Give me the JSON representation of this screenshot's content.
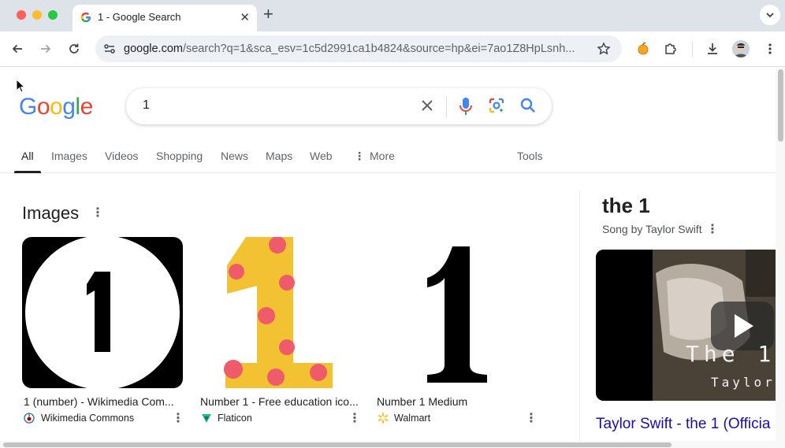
{
  "browser": {
    "tab_title": "1 - Google Search",
    "url_host": "google.com",
    "url_path": "/search?q=1&sca_esv=1c5d2991ca1b4824&source=hp&ei=7ao1Z8HpLsnh..."
  },
  "search": {
    "logo_text": "Google",
    "query": "1"
  },
  "nav": {
    "tabs": [
      "All",
      "Images",
      "Videos",
      "Shopping",
      "News",
      "Maps",
      "Web",
      "More"
    ],
    "tools": "Tools"
  },
  "images_section": {
    "heading": "Images",
    "items": [
      {
        "title": "1 (number) - Wikimedia Com...",
        "source": "Wikimedia Commons"
      },
      {
        "title": "Number 1 - Free education ico...",
        "source": "Flaticon"
      },
      {
        "title": "Number 1 Medium",
        "source": "Walmart"
      }
    ]
  },
  "knowledge_panel": {
    "title": "the 1",
    "subtitle": "Song by Taylor Swift",
    "video_overlay_line1": "The 1",
    "video_overlay_line2": "Taylor",
    "video_link": "Taylor Swift - the 1 (Officia"
  },
  "colors": {
    "google_blue": "#4285f4",
    "google_red": "#ea4335",
    "google_yellow": "#fbbc05",
    "google_green": "#34a853",
    "link": "#1a0dab"
  }
}
